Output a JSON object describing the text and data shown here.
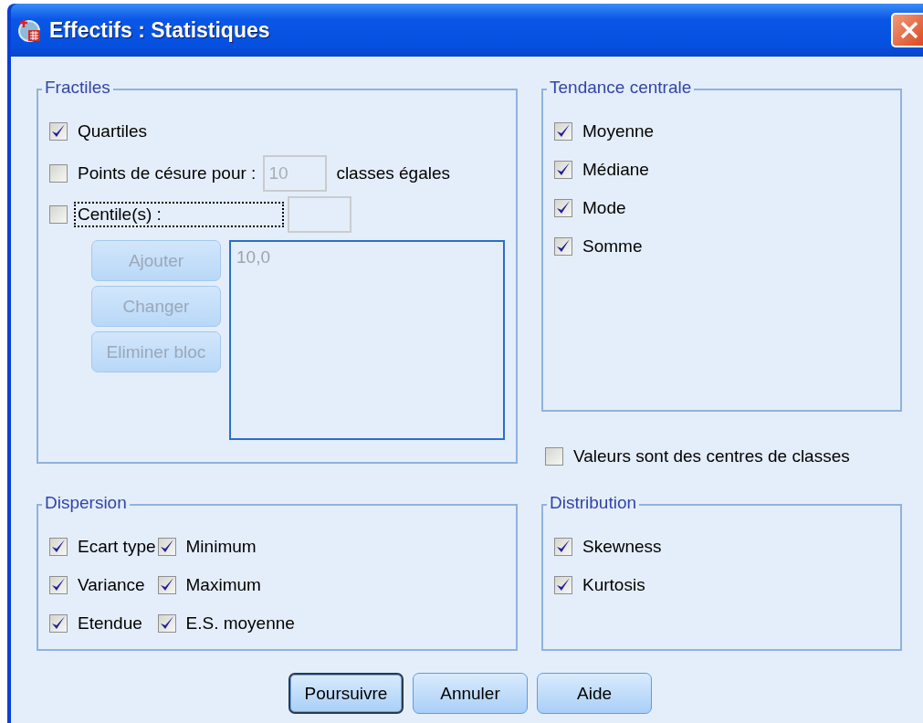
{
  "window": {
    "title": "Effectifs : Statistiques"
  },
  "fractiles": {
    "title": "Fractiles",
    "quartiles": {
      "label": "Quartiles",
      "checked": true
    },
    "cut_points": {
      "label": "Points de césure pour :",
      "checked": false,
      "field": {
        "value": "10",
        "disabled": true
      },
      "suffix": "classes égales"
    },
    "centiles": {
      "label": "Centile(s) :",
      "checked": false,
      "focused": true,
      "field": {
        "disabled": true
      }
    },
    "buttons": [
      {
        "label": "Ajouter",
        "disabled": true
      },
      {
        "label": "Changer",
        "disabled": true
      },
      {
        "label": "Eliminer bloc",
        "disabled": true
      }
    ],
    "list": {
      "items": [
        "10,0"
      ],
      "disabled": true
    }
  },
  "central_tendency": {
    "title": "Tendance centrale",
    "items": [
      {
        "label": "Moyenne",
        "checked": true
      },
      {
        "label": "Médiane",
        "checked": true
      },
      {
        "label": "Mode",
        "checked": true
      },
      {
        "label": "Somme",
        "checked": true
      }
    ]
  },
  "midpoints": {
    "label": "Valeurs sont des centres de classes",
    "checked": false
  },
  "dispersion": {
    "title": "Dispersion",
    "items": [
      {
        "label": "Ecart type",
        "checked": true
      },
      {
        "label": "Minimum",
        "checked": true
      },
      {
        "label": "Variance",
        "checked": true
      },
      {
        "label": "Maximum",
        "checked": true
      },
      {
        "label": "Etendue",
        "checked": true
      },
      {
        "label": "E.S. moyenne",
        "checked": true
      }
    ]
  },
  "distribution": {
    "title": "Distribution",
    "items": [
      {
        "label": "Skewness",
        "checked": true
      },
      {
        "label": "Kurtosis",
        "checked": true
      }
    ]
  },
  "buttons": [
    {
      "label": "Poursuivre",
      "default": true
    },
    {
      "label": "Annuler",
      "default": false
    },
    {
      "label": "Aide",
      "default": false
    }
  ]
}
